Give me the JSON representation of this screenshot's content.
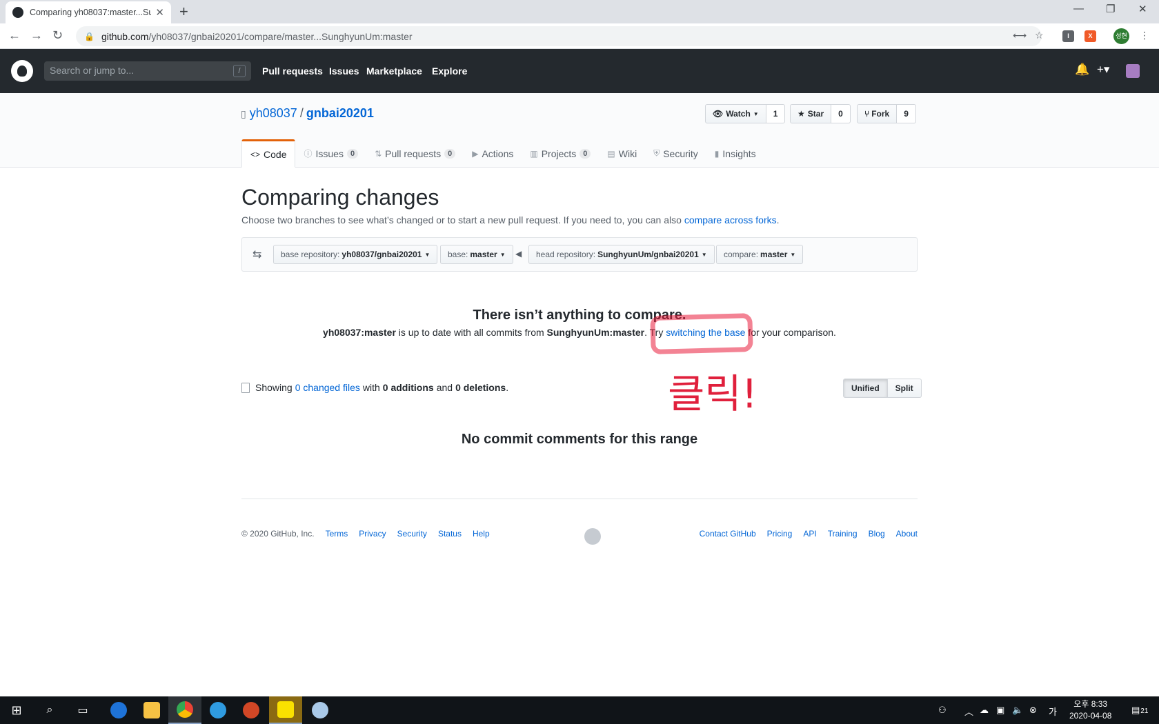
{
  "browser": {
    "tab_title": "Comparing yh08037:master...Su",
    "url_host": "github.com",
    "url_path": "/yh08037/gnbai20201/compare/master...SunghyunUm:master",
    "profile_label": "성현"
  },
  "header": {
    "search_placeholder": "Search or jump to...",
    "search_shortcut": "/",
    "nav": [
      "Pull requests",
      "Issues",
      "Marketplace",
      "Explore"
    ]
  },
  "repo": {
    "owner": "yh08037",
    "separator": "/",
    "name": "gnbai20201",
    "watch_label": "Watch",
    "watch_count": "1",
    "star_label": "Star",
    "star_count": "0",
    "fork_label": "Fork",
    "fork_count": "9",
    "tabs": [
      {
        "label": "Code",
        "count": ""
      },
      {
        "label": "Issues",
        "count": "0"
      },
      {
        "label": "Pull requests",
        "count": "0"
      },
      {
        "label": "Actions",
        "count": ""
      },
      {
        "label": "Projects",
        "count": "0"
      },
      {
        "label": "Wiki",
        "count": ""
      },
      {
        "label": "Security",
        "count": ""
      },
      {
        "label": "Insights",
        "count": ""
      }
    ]
  },
  "compare": {
    "heading": "Comparing changes",
    "desc_prefix": "Choose two branches to see what’s changed or to start a new pull request. If you need to, you can also ",
    "desc_link": "compare across forks",
    "desc_suffix": ".",
    "base_repo_label": "base repository:",
    "base_repo_value": "yh08037/gnbai20201",
    "base_label": "base:",
    "base_value": "master",
    "head_repo_label": "head repository:",
    "head_repo_value": "SunghyunUm/gnbai20201",
    "compare_label": "compare:",
    "compare_value": "master"
  },
  "blank": {
    "title": "There isn’t anything to compare.",
    "base_ref": "yh08037:master",
    "mid_text": " is up to date with all commits from ",
    "head_ref": "SunghyunUm:master",
    "try_text": ". Try ",
    "link": "switching the base",
    "tail": " for your comparison."
  },
  "toc": {
    "showing": "Showing ",
    "changed_files": "0 changed files",
    "with": " with ",
    "additions": "0 additions",
    "and": " and ",
    "deletions": "0 deletions",
    "end": "."
  },
  "diffview": {
    "unified": "Unified",
    "split": "Split"
  },
  "no_comments": "No commit comments for this range",
  "footer": {
    "copyright": "© 2020 GitHub, Inc.",
    "left_links": [
      "Terms",
      "Privacy",
      "Security",
      "Status",
      "Help"
    ],
    "right_links": [
      "Contact GitHub",
      "Pricing",
      "API",
      "Training",
      "Blog",
      "About"
    ]
  },
  "annotation": {
    "text": "클릭!",
    "color": "#e0203c"
  },
  "taskbar": {
    "clock_period": "오후 8:33",
    "clock_date": "2020-04-08",
    "notification_count": "21"
  }
}
